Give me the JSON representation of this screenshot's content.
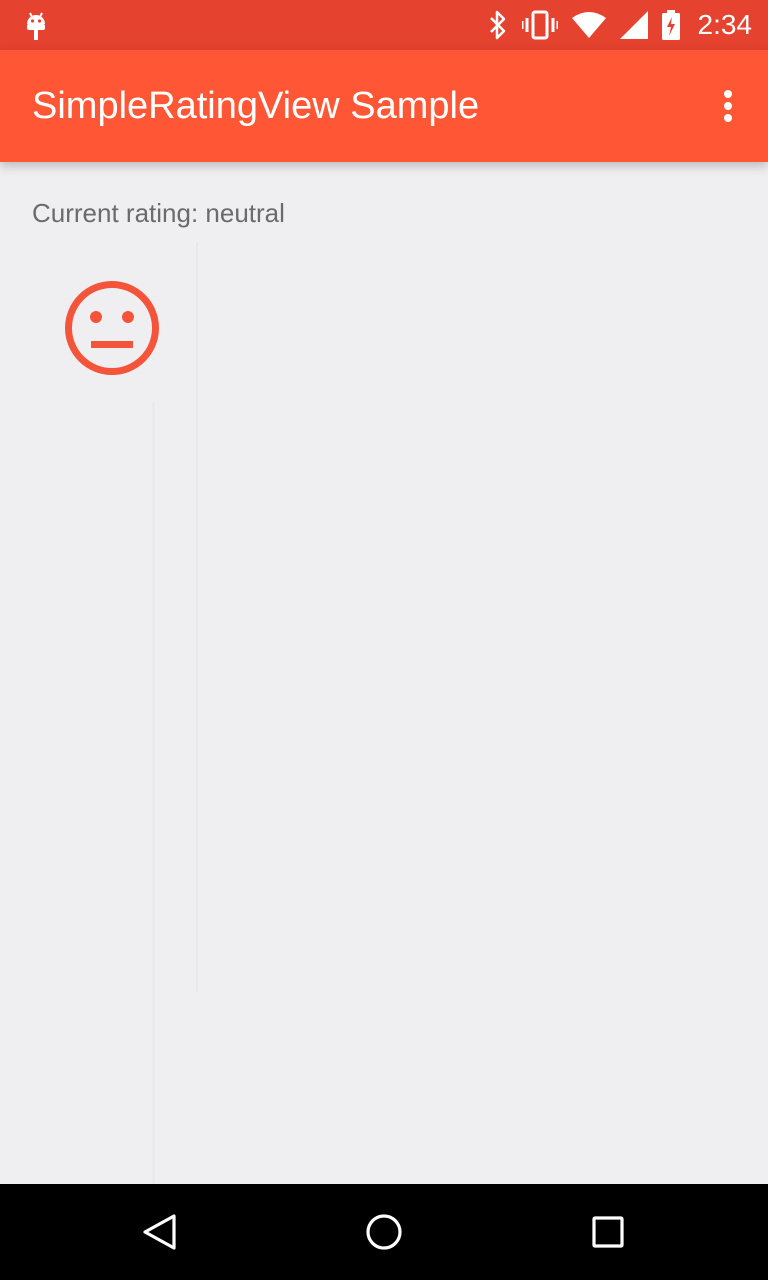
{
  "status_bar": {
    "time": "2:34",
    "icons": [
      "android-notification-icon",
      "bluetooth-icon",
      "vibrate-icon",
      "wifi-icon",
      "signal-icon",
      "battery-charging-icon"
    ]
  },
  "app_bar": {
    "title": "SimpleRatingView Sample",
    "overflow_icon": "more-vert-icon"
  },
  "main": {
    "rating_label": "Current rating: neutral",
    "rating_icon": "neutral-face-icon",
    "rating_value": "neutral"
  },
  "nav_bar": {
    "buttons": [
      "back-icon",
      "home-icon",
      "recents-icon"
    ]
  },
  "colors": {
    "status_bar": "#e64230",
    "app_bar": "#ff5735",
    "accent": "#f4543a",
    "background": "#efeff2",
    "label_text": "#6b6b6b",
    "nav_bar": "#000000"
  }
}
